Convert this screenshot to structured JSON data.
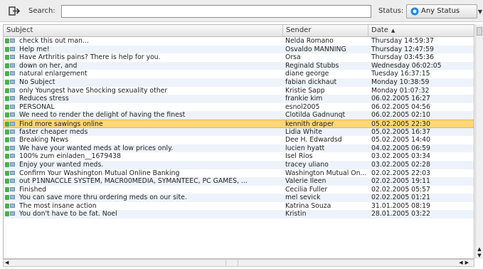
{
  "toolbar": {
    "search_label": "Search:",
    "search_value": "",
    "status_label": "Status:",
    "status_value": "Any Status"
  },
  "columns": {
    "subject": "Subject",
    "sender": "Sender",
    "date": "Date"
  },
  "rows": [
    {
      "subject": "check this out man...",
      "sender": "Nelda Romano",
      "date": "Thursday 14:59:37"
    },
    {
      "subject": "Help me!",
      "sender": "Osvaldo MANNING",
      "date": "Thursday 12:47:59"
    },
    {
      "subject": "Have Arthritis pains? There is help for you.",
      "sender": "Orsa",
      "date": "Thursday 03:45:36"
    },
    {
      "subject": "down on her, and",
      "sender": "Reginald Stubbs",
      "date": "Wednesday 06:02:05"
    },
    {
      "subject": "natural enlargement",
      "sender": "diane george",
      "date": "Tuesday 16:37:15"
    },
    {
      "subject": "No Subject",
      "sender": "fabian dickhaut",
      "date": "Monday 10:38:59"
    },
    {
      "subject": "only Youngest have Shocking sexuality other",
      "sender": "Kristie Sapp",
      "date": "Monday 01:07:32"
    },
    {
      "subject": "Reduces stress",
      "sender": "frankie kim",
      "date": "06.02.2005 16:27"
    },
    {
      "subject": "PERSONAL",
      "sender": "esnol2005",
      "date": "06.02.2005 04:56"
    },
    {
      "subject": "We need to render the delight of having the finest",
      "sender": "Clotilda Gadnunqt",
      "date": "06.02.2005 02:10"
    },
    {
      "subject": "Find more sawings online",
      "sender": "kennith draper",
      "date": "05.02.2005 22:30"
    },
    {
      "subject": "faster cheaper meds",
      "sender": "Lidia White",
      "date": "05.02.2005 16:37"
    },
    {
      "subject": "Breaking News",
      "sender": "Dee H. Edwardsd",
      "date": "05.02.2005 14:40"
    },
    {
      "subject": "We have your wanted meds at low prices only.",
      "sender": "lucien hyatt",
      "date": "04.02.2005 06:59"
    },
    {
      "subject": "100% zum einladen__1679438",
      "sender": "Isel Rios",
      "date": "03.02.2005 03:34"
    },
    {
      "subject": "Enjoy your wanted meds.",
      "sender": "tracey uliano",
      "date": "03.02.2005 02:28"
    },
    {
      "subject": "Confirm Your Washington Mutual Online Banking",
      "sender": "Washington Mutual On...",
      "date": "02.02.2005 22:03"
    },
    {
      "subject": "out P1NNACCLE SYSTEM, MACR00MEDIA, SYMANTEEC, PC GAMES, ...",
      "sender": "Valerie Ileen",
      "date": "02.02.2005 19:11"
    },
    {
      "subject": "Finished",
      "sender": "Cecilia Fuller",
      "date": "02.02.2005 05:57"
    },
    {
      "subject": "You can save more thru ordering meds on our site.",
      "sender": "mel sevick",
      "date": "02.02.2005 01:21"
    },
    {
      "subject": "The most insane action",
      "sender": "Katrina Souza",
      "date": "31.01.2005 08:19"
    },
    {
      "subject": "You don't have to be fat. Noel",
      "sender": "Kristin",
      "date": "28.01.2005 03:22"
    }
  ],
  "selected_index": 10,
  "colors": {
    "selection": "#ffd778",
    "row_alt": "#eef3fb",
    "toolbar": "#ededed",
    "status_icon": "#1e88e5"
  }
}
